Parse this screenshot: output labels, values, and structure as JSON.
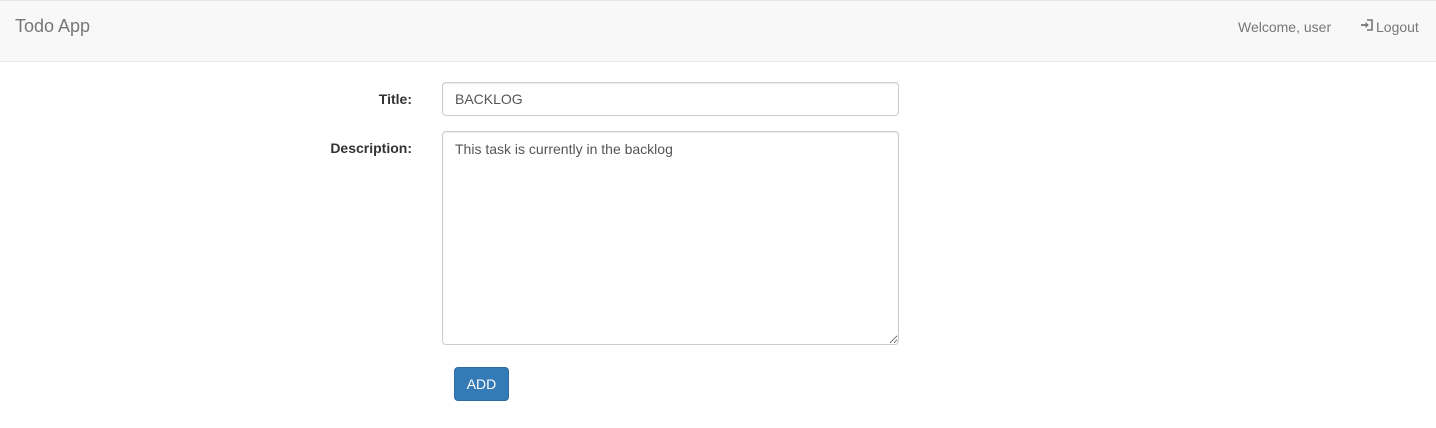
{
  "navbar": {
    "brand": "Todo App",
    "welcome_text": "Welcome, user",
    "logout_label": "Logout",
    "logout_icon": "log-in-icon"
  },
  "form": {
    "title_label": "Title:",
    "title_value": "BACKLOG",
    "description_label": "Description:",
    "description_value": "This task is currently in the backlog",
    "add_button_label": "ADD"
  },
  "colors": {
    "navbar_bg": "#f8f8f8",
    "primary": "#337ab7",
    "muted_text": "#777777"
  }
}
